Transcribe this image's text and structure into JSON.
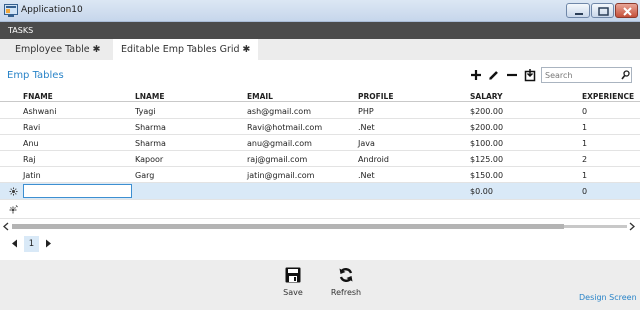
{
  "window": {
    "title": "Application10"
  },
  "tasks": {
    "label": "TASKS"
  },
  "tabs": [
    {
      "label": "Employee Table ✱"
    },
    {
      "label": "Editable Emp Tables Grid ✱"
    }
  ],
  "section": {
    "title": "Emp Tables"
  },
  "toolbar": {
    "icons": [
      "add-icon",
      "edit-icon",
      "delete-icon",
      "export-icon"
    ],
    "search_placeholder": "Search"
  },
  "grid": {
    "columns": [
      "FNAME",
      "LNAME",
      "EMAIL",
      "PROFILE",
      "SALARY",
      "EXPERIENCE"
    ],
    "rows": [
      [
        "Ashwani",
        "Tyagi",
        "ash@gmail.com",
        "PHP",
        "$200.00",
        "0"
      ],
      [
        "Ravi",
        "Sharma",
        "Ravi@hotmail.com",
        ".Net",
        "$200.00",
        "1"
      ],
      [
        "Anu",
        "Sharma",
        "anu@gmail.com",
        "Java",
        "$100.00",
        "1"
      ],
      [
        "Raj",
        "Kapoor",
        "raj@gmail.com",
        "Android",
        "$125.00",
        "2"
      ],
      [
        "Jatin",
        "Garg",
        "jatin@gmail.com",
        ".Net",
        "$150.00",
        "1"
      ]
    ],
    "new_row": {
      "salary": "$0.00",
      "experience": "0"
    }
  },
  "pager": {
    "current_page": "1"
  },
  "commands": {
    "save": "Save",
    "refresh": "Refresh"
  },
  "footer": {
    "design_screen": "Design Screen"
  },
  "colors": {
    "accent": "#2a84c8",
    "tasks_bar": "#4b4b4b",
    "selected_row": "#d9e9f7"
  }
}
